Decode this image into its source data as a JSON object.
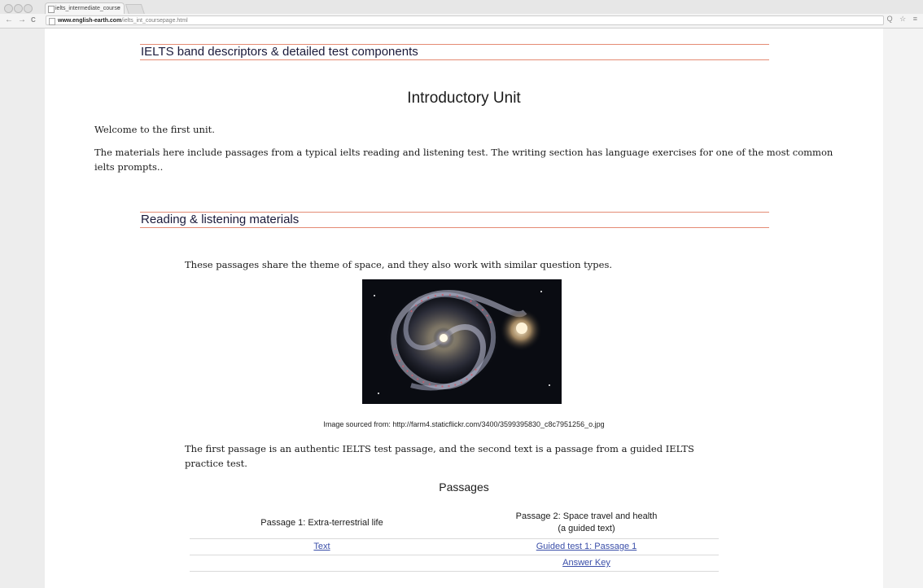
{
  "browser": {
    "tab_title": "ielts_intermediate_course",
    "tab_close": "×",
    "url_host": "www.english-earth.com",
    "url_path": "/ielts_int_coursepage.html",
    "back": "←",
    "forward": "→",
    "reload": "C",
    "right_icons": "Q ☆ ≡"
  },
  "header_section": {
    "title": "IELTS band descriptors & detailed test components"
  },
  "unit": {
    "title": "Introductory Unit",
    "welcome": "Welcome to the first unit.",
    "intro": "The materials here include passages from a typical ielts reading and listening test. The writing section has language exercises for one of the most common ielts prompts.."
  },
  "reading_section": {
    "title": "Reading & listening materials",
    "theme": "These passages share the theme of space, and they also work with similar question types.",
    "image_caption": "Image sourced from: http://farm4.staticflickr.com/3400/3599395830_c8c7951256_o.jpg",
    "description": "The first passage is an authentic IELTS test passage, and the second text is a passage from a guided IELTS practice test."
  },
  "passages": {
    "title": "Passages",
    "col1_header": "Passage 1: Extra-terrestrial life",
    "col2_header_line1": "Passage 2: Space travel and health",
    "col2_header_line2": "(a guided text)",
    "row1_col1": "Text",
    "row1_col2": "Guided test 1: Passage 1",
    "row2_col2": "Answer Key"
  }
}
